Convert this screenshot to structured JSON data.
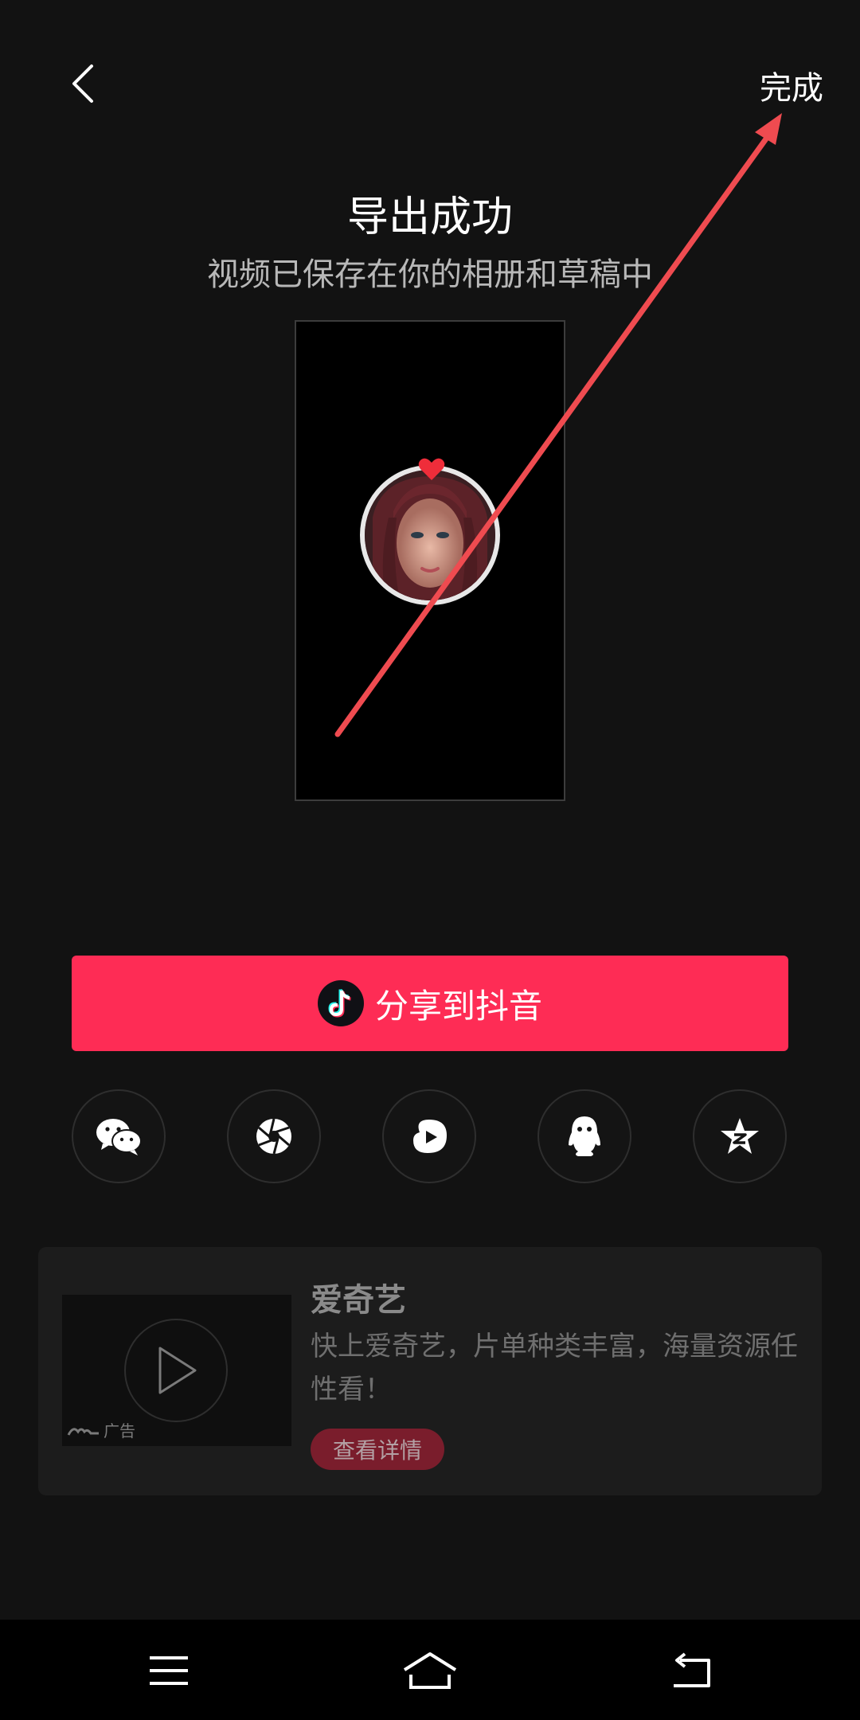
{
  "header": {
    "done_label": "完成"
  },
  "export": {
    "title": "导出成功",
    "subtitle": "视频已保存在你的相册和草稿中"
  },
  "share": {
    "label": "分享到抖音",
    "accent_color": "#fe2c55"
  },
  "social_icons": [
    "wechat-icon",
    "moments-icon",
    "weishi-icon",
    "qq-icon",
    "qzone-icon"
  ],
  "ad": {
    "app_name": "爱奇艺",
    "description": "快上爱奇艺，片单种类丰富，海量资源任性看！",
    "tag": "广告",
    "detail_label": "查看详情"
  },
  "nav": [
    "menu-icon",
    "home-icon",
    "back-nav-icon"
  ]
}
